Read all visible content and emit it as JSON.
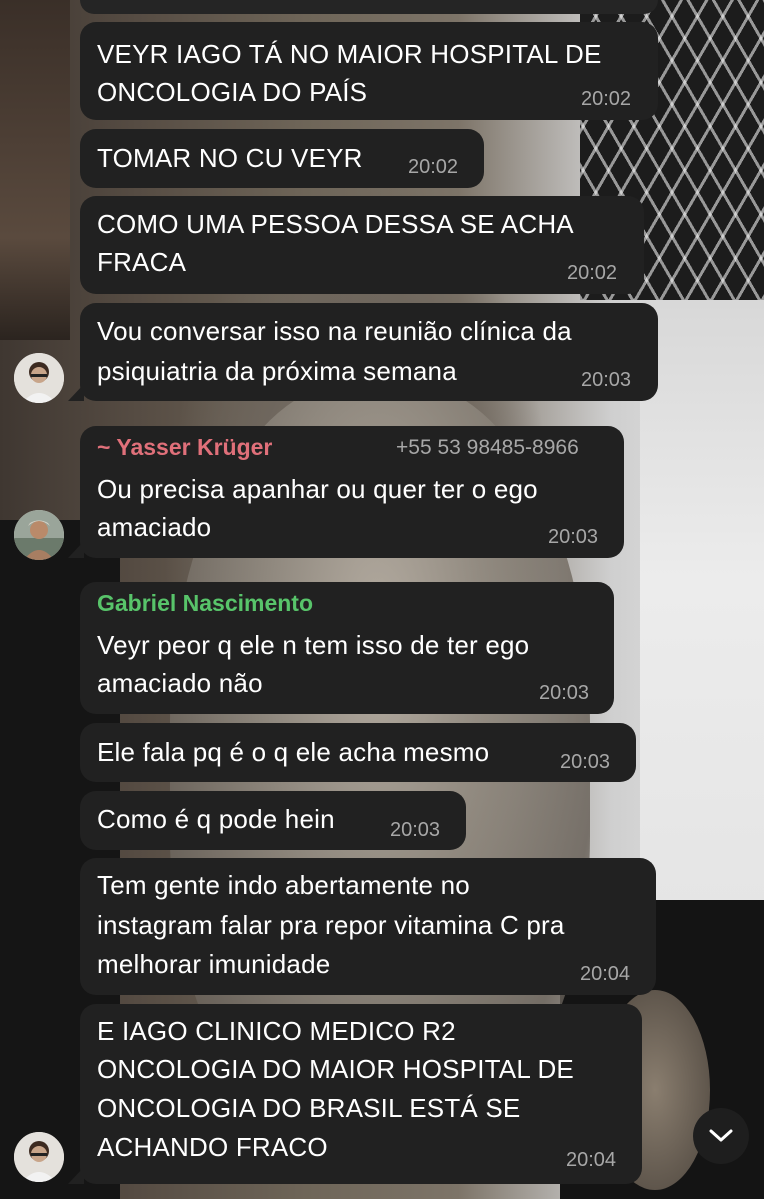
{
  "messages": [
    {
      "id": "m1",
      "lines": [
        "VEYR IAGO TÁ NO MAIOR HOSPITAL DE",
        "ONCOLOGIA DO PAÍS"
      ],
      "time": "20:02"
    },
    {
      "id": "m2",
      "lines": [
        "TOMAR NO CU VEYR"
      ],
      "time": "20:02"
    },
    {
      "id": "m3",
      "lines": [
        "COMO UMA PESSOA DESSA SE ACHA",
        "FRACA"
      ],
      "time": "20:02"
    },
    {
      "id": "m4",
      "lines": [
        "Vou conversar isso na reunião clínica da",
        "psiquiatria da próxima semana"
      ],
      "time": "20:03"
    },
    {
      "id": "m5",
      "sender": "~ Yasser Krüger",
      "phone": "+55 53 98485-8966",
      "sender_color": "#e0707a",
      "lines": [
        "Ou precisa apanhar ou quer ter o ego",
        "amaciado"
      ],
      "time": "20:03"
    },
    {
      "id": "m6",
      "sender": "Gabriel Nascimento",
      "sender_color": "#58c46a",
      "lines": [
        "Veyr peor q ele n tem isso de ter ego",
        "amaciado não"
      ],
      "time": "20:03"
    },
    {
      "id": "m7",
      "lines": [
        "Ele fala pq é o q ele acha mesmo"
      ],
      "time": "20:03"
    },
    {
      "id": "m8",
      "lines": [
        "Como é q pode hein"
      ],
      "time": "20:03"
    },
    {
      "id": "m9",
      "lines": [
        "Tem gente indo abertamente no",
        "instagram falar pra repor vitamina C pra",
        "melhorar imunidade"
      ],
      "time": "20:04"
    },
    {
      "id": "m10",
      "lines": [
        "E IAGO CLINICO MEDICO R2",
        "ONCOLOGIA DO MAIOR HOSPITAL DE",
        "ONCOLOGIA DO BRASIL ESTÁ SE",
        "ACHANDO FRACO"
      ],
      "time": "20:04"
    }
  ],
  "colors": {
    "bubble": "#212121",
    "text": "#ffffff",
    "meta": "#a7a7a7"
  },
  "icons": {
    "scroll_down": "chevron-down-icon"
  }
}
